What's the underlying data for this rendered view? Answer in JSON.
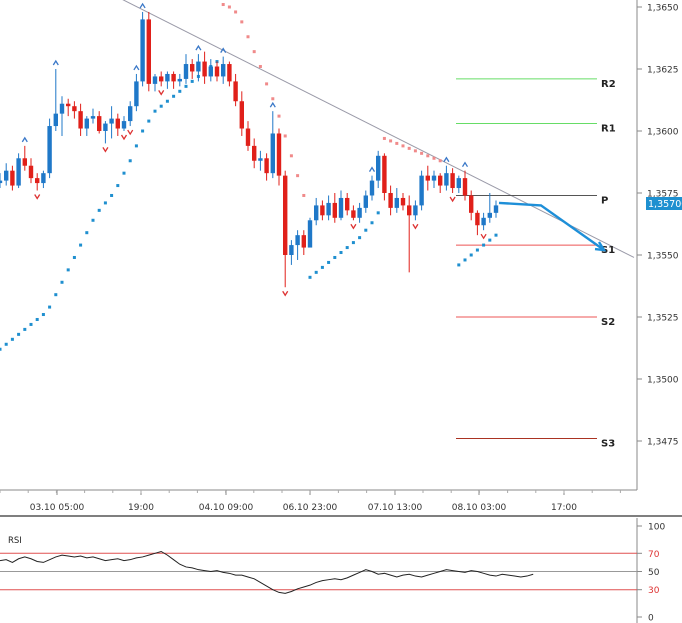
{
  "chart_data": [
    {
      "type": "candlestick",
      "title": "",
      "y_ticks": [
        "1,3650",
        "1,3625",
        "1,3600",
        "1,3575",
        "1,3550",
        "1,3525",
        "1,3500",
        "1,3475"
      ],
      "y_tick_values": [
        1.365,
        1.3625,
        1.36,
        1.3575,
        1.355,
        1.3525,
        1.35,
        1.3475
      ],
      "ylim": [
        1.3439,
        1.3658
      ],
      "x_ticks": [
        "03.10 05:00",
        "19:00",
        "04.10 09:00",
        "06.10 23:00",
        "07.10 13:00",
        "08.10 03:00",
        "17:00"
      ],
      "current_price": "1,35700",
      "current_price_value": 1.357,
      "candles": [
        [
          1.3579,
          1.3583,
          1.3577,
          1.358
        ],
        [
          1.358,
          1.3587,
          1.3578,
          1.3584
        ],
        [
          1.3584,
          1.3586,
          1.3576,
          1.3578
        ],
        [
          1.3578,
          1.3591,
          1.3577,
          1.3589
        ],
        [
          1.3589,
          1.3594,
          1.3584,
          1.3586
        ],
        [
          1.3586,
          1.3589,
          1.3579,
          1.3581
        ],
        [
          1.3581,
          1.3583,
          1.3576,
          1.3579
        ],
        [
          1.3579,
          1.3584,
          1.3577,
          1.3583
        ],
        [
          1.3583,
          1.3605,
          1.3581,
          1.3602
        ],
        [
          1.3602,
          1.3625,
          1.36,
          1.3607
        ],
        [
          1.3607,
          1.3614,
          1.3598,
          1.3611
        ],
        [
          1.3611,
          1.3613,
          1.3606,
          1.361
        ],
        [
          1.361,
          1.3612,
          1.3605,
          1.3608
        ],
        [
          1.3608,
          1.3611,
          1.3598,
          1.3601
        ],
        [
          1.3601,
          1.3606,
          1.3598,
          1.3605
        ],
        [
          1.3605,
          1.3609,
          1.3603,
          1.3606
        ],
        [
          1.3606,
          1.3608,
          1.3599,
          1.36
        ],
        [
          1.36,
          1.3604,
          1.3595,
          1.3603
        ],
        [
          1.3603,
          1.361,
          1.3597,
          1.3605
        ],
        [
          1.3605,
          1.3607,
          1.3598,
          1.3601
        ],
        [
          1.3601,
          1.3606,
          1.36,
          1.3604
        ],
        [
          1.3604,
          1.3612,
          1.3602,
          1.361
        ],
        [
          1.361,
          1.3623,
          1.3608,
          1.362
        ],
        [
          1.362,
          1.3648,
          1.3618,
          1.3645
        ],
        [
          1.3645,
          1.3648,
          1.3616,
          1.3619
        ],
        [
          1.3619,
          1.3623,
          1.3616,
          1.3622
        ],
        [
          1.3622,
          1.3624,
          1.3618,
          1.362
        ],
        [
          1.362,
          1.3624,
          1.3617,
          1.3623
        ],
        [
          1.3623,
          1.3624,
          1.3617,
          1.362
        ],
        [
          1.362,
          1.3623,
          1.3618,
          1.3621
        ],
        [
          1.3621,
          1.3631,
          1.3619,
          1.3627
        ],
        [
          1.3627,
          1.3629,
          1.3621,
          1.3624
        ],
        [
          1.3624,
          1.3631,
          1.362,
          1.3628
        ],
        [
          1.3628,
          1.3632,
          1.3619,
          1.3622
        ],
        [
          1.3622,
          1.3629,
          1.362,
          1.3626
        ],
        [
          1.3626,
          1.3628,
          1.362,
          1.3622
        ],
        [
          1.3622,
          1.363,
          1.3619,
          1.3627
        ],
        [
          1.3627,
          1.3628,
          1.3618,
          1.362
        ],
        [
          1.362,
          1.3623,
          1.361,
          1.3612
        ],
        [
          1.3612,
          1.3616,
          1.3598,
          1.3601
        ],
        [
          1.3601,
          1.3604,
          1.3592,
          1.3594
        ],
        [
          1.3594,
          1.3597,
          1.3585,
          1.3588
        ],
        [
          1.3588,
          1.3592,
          1.3584,
          1.3589
        ],
        [
          1.3589,
          1.3591,
          1.358,
          1.3583
        ],
        [
          1.3583,
          1.3608,
          1.3581,
          1.3599
        ],
        [
          1.3599,
          1.3601,
          1.3578,
          1.3582
        ],
        [
          1.3582,
          1.3584,
          1.3537,
          1.355
        ],
        [
          1.355,
          1.3556,
          1.3546,
          1.3554
        ],
        [
          1.3554,
          1.356,
          1.3548,
          1.3558
        ],
        [
          1.3558,
          1.356,
          1.355,
          1.3553
        ],
        [
          1.3553,
          1.3565,
          1.356,
          1.3564
        ],
        [
          1.3564,
          1.3573,
          1.3562,
          1.357
        ],
        [
          1.357,
          1.3572,
          1.3564,
          1.3566
        ],
        [
          1.3566,
          1.3574,
          1.3564,
          1.3571
        ],
        [
          1.3571,
          1.3575,
          1.3563,
          1.3565
        ],
        [
          1.3565,
          1.3576,
          1.3564,
          1.3573
        ],
        [
          1.3573,
          1.3575,
          1.3566,
          1.3568
        ],
        [
          1.3568,
          1.357,
          1.3564,
          1.3565
        ],
        [
          1.3565,
          1.3571,
          1.3563,
          1.3569
        ],
        [
          1.3569,
          1.3576,
          1.3567,
          1.3574
        ],
        [
          1.3574,
          1.3582,
          1.3572,
          1.358
        ],
        [
          1.358,
          1.3592,
          1.3577,
          1.359
        ],
        [
          1.359,
          1.3591,
          1.3572,
          1.3575
        ],
        [
          1.3575,
          1.3578,
          1.3566,
          1.3569
        ],
        [
          1.3569,
          1.3577,
          1.3567,
          1.3573
        ],
        [
          1.3573,
          1.3575,
          1.3568,
          1.357
        ],
        [
          1.357,
          1.3574,
          1.3543,
          1.3566
        ],
        [
          1.3566,
          1.3572,
          1.3564,
          1.357
        ],
        [
          1.357,
          1.3584,
          1.3568,
          1.3582
        ],
        [
          1.3582,
          1.3586,
          1.3576,
          1.358
        ],
        [
          1.358,
          1.3584,
          1.3577,
          1.3582
        ],
        [
          1.3582,
          1.3583,
          1.3575,
          1.3578
        ],
        [
          1.3578,
          1.3586,
          1.3576,
          1.3583
        ],
        [
          1.3583,
          1.3585,
          1.3575,
          1.3577
        ],
        [
          1.3577,
          1.3582,
          1.3575,
          1.3581
        ],
        [
          1.3581,
          1.3584,
          1.3572,
          1.3574
        ],
        [
          1.3574,
          1.3576,
          1.3564,
          1.3567
        ],
        [
          1.3567,
          1.3568,
          1.3558,
          1.3562
        ],
        [
          1.3562,
          1.3567,
          1.356,
          1.3565
        ],
        [
          1.3565,
          1.3575,
          1.3563,
          1.3567
        ],
        [
          1.3567,
          1.3572,
          1.3565,
          1.357
        ]
      ],
      "sar_points": [
        [
          0,
          1.3512
        ],
        [
          1,
          1.3514
        ],
        [
          2,
          1.3516
        ],
        [
          3,
          1.3518
        ],
        [
          4,
          1.352
        ],
        [
          5,
          1.3522
        ],
        [
          6,
          1.3524
        ],
        [
          7,
          1.3526
        ],
        [
          8,
          1.3529
        ],
        [
          9,
          1.3534
        ],
        [
          10,
          1.3539
        ],
        [
          11,
          1.3544
        ],
        [
          12,
          1.3549
        ],
        [
          13,
          1.3554
        ],
        [
          14,
          1.3559
        ],
        [
          15,
          1.3564
        ],
        [
          16,
          1.3568
        ],
        [
          17,
          1.3571
        ],
        [
          18,
          1.3574
        ],
        [
          19,
          1.3578
        ],
        [
          20,
          1.3583
        ],
        [
          21,
          1.3588
        ],
        [
          22,
          1.3594
        ],
        [
          23,
          1.36
        ],
        [
          24,
          1.3604
        ],
        [
          25,
          1.3608
        ],
        [
          26,
          1.361
        ],
        [
          27,
          1.3612
        ],
        [
          28,
          1.3614
        ],
        [
          29,
          1.3616
        ],
        [
          30,
          1.3618
        ],
        [
          31,
          1.362
        ],
        [
          32,
          1.3622
        ],
        [
          33,
          1.3624
        ],
        [
          34,
          1.3626
        ],
        [
          35,
          1.3628
        ],
        [
          36,
          1.3651
        ],
        [
          37,
          1.365
        ],
        [
          38,
          1.3648
        ],
        [
          39,
          1.3644
        ],
        [
          40,
          1.3638
        ],
        [
          41,
          1.3632
        ],
        [
          42,
          1.3626
        ],
        [
          43,
          1.3619
        ],
        [
          44,
          1.3613
        ],
        [
          45,
          1.3606
        ],
        [
          46,
          1.3598
        ],
        [
          47,
          1.359
        ],
        [
          48,
          1.3582
        ],
        [
          49,
          1.3574
        ],
        [
          50,
          1.3541
        ],
        [
          51,
          1.3543
        ],
        [
          52,
          1.3545
        ],
        [
          53,
          1.3547
        ],
        [
          54,
          1.3549
        ],
        [
          55,
          1.3551
        ],
        [
          56,
          1.3553
        ],
        [
          57,
          1.3555
        ],
        [
          58,
          1.3557
        ],
        [
          59,
          1.356
        ],
        [
          60,
          1.3563
        ],
        [
          61,
          1.3567
        ],
        [
          62,
          1.3597
        ],
        [
          63,
          1.3596
        ],
        [
          64,
          1.3595
        ],
        [
          65,
          1.3594
        ],
        [
          66,
          1.3593
        ],
        [
          67,
          1.3592
        ],
        [
          68,
          1.3591
        ],
        [
          69,
          1.359
        ],
        [
          70,
          1.3589
        ],
        [
          71,
          1.3588
        ],
        [
          74,
          1.3546
        ],
        [
          75,
          1.3548
        ],
        [
          76,
          1.355
        ],
        [
          77,
          1.3552
        ],
        [
          78,
          1.3554
        ],
        [
          79,
          1.3556
        ],
        [
          80,
          1.3558
        ]
      ],
      "fractal_up_idx": [
        4,
        9,
        22,
        23,
        32,
        36,
        44,
        60,
        72,
        75
      ],
      "fractal_down_idx": [
        6,
        17,
        20,
        21,
        26,
        46,
        57,
        67,
        73,
        78
      ],
      "pivot_levels": [
        {
          "label": "R2",
          "value": 1.3621,
          "color": "#66dd66"
        },
        {
          "label": "R1",
          "value": 1.3603,
          "color": "#66dd66"
        },
        {
          "label": "P",
          "value": 1.3574,
          "color": "#555555"
        },
        {
          "label": "S1",
          "value": 1.3554,
          "color": "#ee5555"
        },
        {
          "label": "S2",
          "value": 1.3525,
          "color": "#ee5555"
        },
        {
          "label": "S3",
          "value": 1.3476,
          "color": "#aa3322"
        }
      ],
      "trendline": [
        [
          1.3658,
          1.3549
        ]
      ],
      "forecast_arrow": [
        1.3571,
        1.357,
        1.3552
      ]
    },
    {
      "type": "line",
      "indicator": "RSI",
      "label": "RSI",
      "y_ticks": [
        "100",
        "70",
        "50",
        "30",
        "0"
      ],
      "y_tick_values": [
        100,
        70,
        50,
        30,
        0
      ],
      "ylim": [
        0,
        100
      ],
      "levels": [
        70,
        50,
        30
      ],
      "values": [
        62,
        63,
        60,
        64,
        66,
        64,
        61,
        60,
        63,
        66,
        68,
        67,
        66,
        67,
        65,
        66,
        64,
        62,
        63,
        64,
        62,
        63,
        65,
        66,
        68,
        70,
        72,
        68,
        63,
        58,
        55,
        54,
        52,
        51,
        50,
        51,
        49,
        48,
        46,
        46,
        44,
        42,
        38,
        34,
        30,
        27,
        26,
        28,
        31,
        33,
        35,
        38,
        40,
        41,
        42,
        41,
        43,
        46,
        49,
        52,
        50,
        47,
        48,
        46,
        44,
        46,
        47,
        45,
        44,
        46,
        48,
        50,
        52,
        51,
        50,
        49,
        51,
        50,
        48,
        46,
        45,
        47,
        46,
        45,
        44,
        45,
        47
      ]
    }
  ]
}
